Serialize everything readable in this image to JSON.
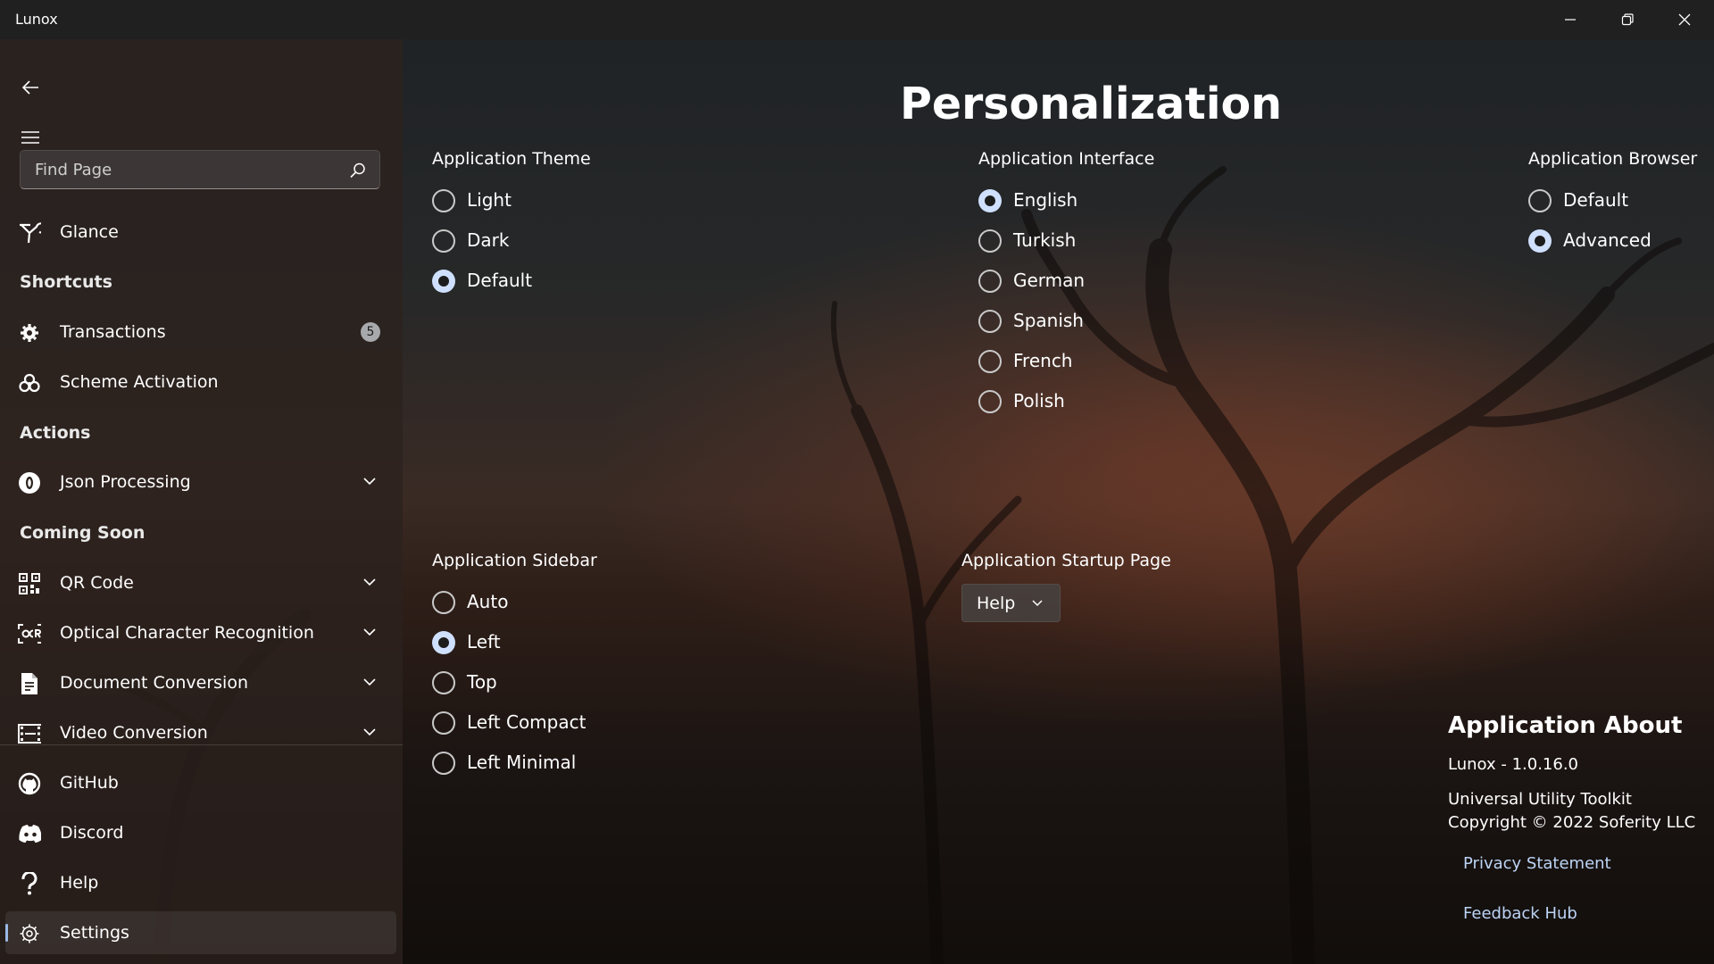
{
  "window": {
    "title": "Lunox"
  },
  "titlebar": {
    "buttons": [
      "minimize-icon",
      "restore-icon",
      "close-icon"
    ]
  },
  "sidebar": {
    "search": {
      "placeholder": "Find Page",
      "icon": "search-icon"
    },
    "items": {
      "glance": {
        "label": "Glance",
        "icon": "glance-icon"
      },
      "transactions": {
        "label": "Transactions",
        "icon": "gear-icon",
        "badge": "5"
      },
      "scheme_activation": {
        "label": "Scheme Activation",
        "icon": "biohazard-icon"
      },
      "json_processing": {
        "label": "Json Processing",
        "icon": "json-icon"
      },
      "qr_code": {
        "label": "QR Code",
        "icon": "qr-code-icon"
      },
      "ocr": {
        "label": "Optical Character Recognition",
        "icon": "ocr-icon"
      },
      "document_conversion": {
        "label": "Document Conversion",
        "icon": "document-icon"
      },
      "video_conversion": {
        "label": "Video Conversion",
        "icon": "film-icon"
      },
      "github": {
        "label": "GitHub",
        "icon": "github-icon"
      },
      "discord": {
        "label": "Discord",
        "icon": "discord-icon"
      },
      "help": {
        "label": "Help",
        "icon": "question-icon"
      },
      "settings": {
        "label": "Settings",
        "icon": "gear-icon",
        "selected": true
      }
    },
    "sections": {
      "shortcuts": "Shortcuts",
      "actions": "Actions",
      "coming_soon": "Coming Soon"
    }
  },
  "main": {
    "title": "Personalization",
    "theme": {
      "title": "Application Theme",
      "options": [
        "Light",
        "Dark",
        "Default"
      ],
      "selected": "Default"
    },
    "interface": {
      "title": "Application Interface",
      "options": [
        "English",
        "Turkish",
        "German",
        "Spanish",
        "French",
        "Polish"
      ],
      "selected": "English"
    },
    "browser": {
      "title": "Application Browser",
      "options": [
        "Default",
        "Advanced"
      ],
      "selected": "Advanced"
    },
    "sidebar_mode": {
      "title": "Application Sidebar",
      "options": [
        "Auto",
        "Left",
        "Top",
        "Left Compact",
        "Left Minimal"
      ],
      "selected": "Left"
    },
    "startup": {
      "title": "Application Startup Page",
      "value": "Help"
    },
    "about": {
      "title": "Application About",
      "version": "Lunox - 1.0.16.0",
      "description": "Universal Utility Toolkit",
      "copyright": "Copyright © 2022 Soferity LLC",
      "privacy_link": "Privacy Statement",
      "feedback_link": "Feedback Hub"
    }
  },
  "colors": {
    "accent": "#cfe0ff",
    "link": "#bcd4f5",
    "selection_bar": "#9ab8e6"
  }
}
